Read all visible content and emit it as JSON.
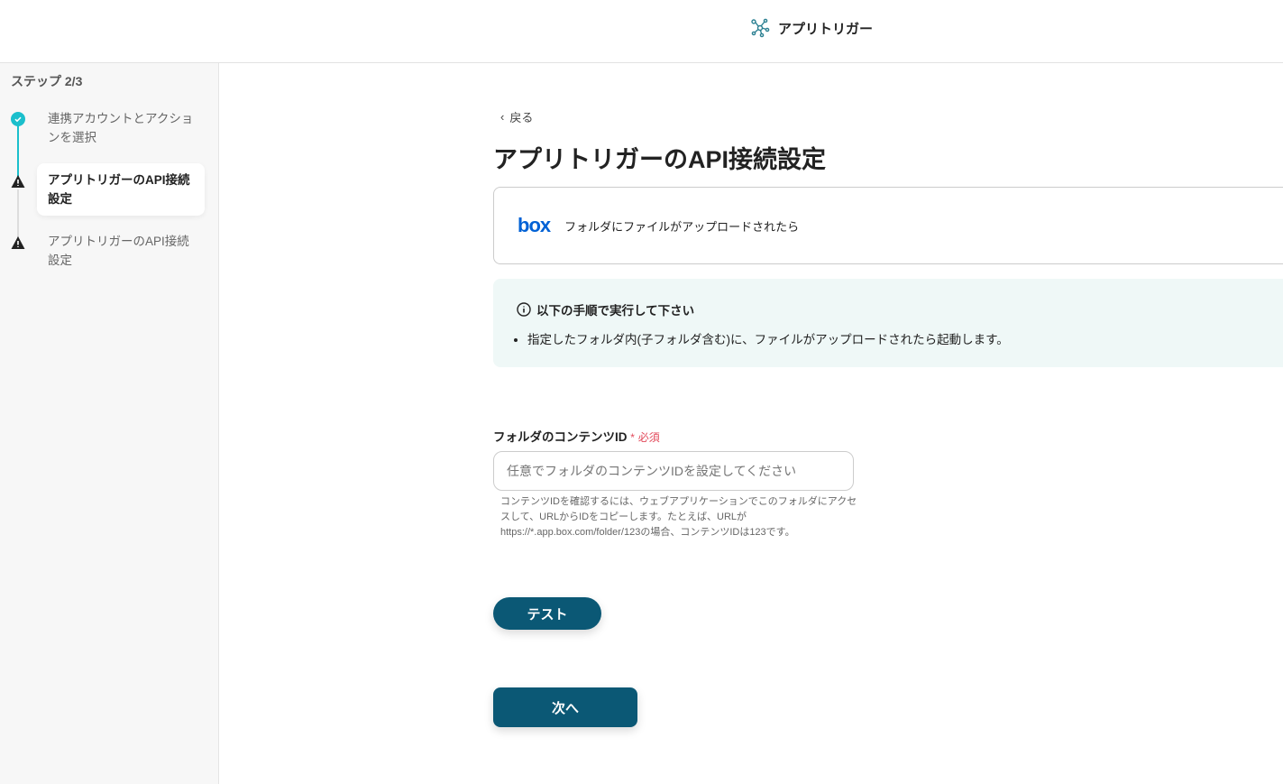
{
  "header": {
    "app_name": "アプリトリガー"
  },
  "sidebar": {
    "step_label": "ステップ 2/3",
    "items": [
      {
        "label": "連携アカウントとアクションを選択",
        "status": "done"
      },
      {
        "label": "アプリトリガーのAPI接続設定",
        "status": "warning"
      },
      {
        "label": "アプリトリガーのAPI接続設定",
        "status": "warning"
      }
    ]
  },
  "main": {
    "back_label": "戻る",
    "title": "アプリトリガーのAPI接続設定",
    "trigger_card": {
      "logo": "box",
      "label": "フォルダにファイルがアップロードされたら"
    },
    "info": {
      "heading": "以下の手順で実行して下さい",
      "items": [
        "指定したフォルダ内(子フォルダ含む)に、ファイルがアップロードされたら起動します。"
      ]
    },
    "field": {
      "label": "フォルダのコンテンツID",
      "required_mark": "*",
      "required_label": "必須",
      "placeholder": "任意でフォルダのコンテンツIDを設定してください",
      "help": "コンテンツIDを確認するには、ウェブアプリケーションでこのフォルダにアクセスして、URLからIDをコピーします。たとえば、URLが https://*.app.box.com/folder/123の場合、コンテンツIDは123です。"
    },
    "test_button": "テスト",
    "next_button": "次へ"
  }
}
